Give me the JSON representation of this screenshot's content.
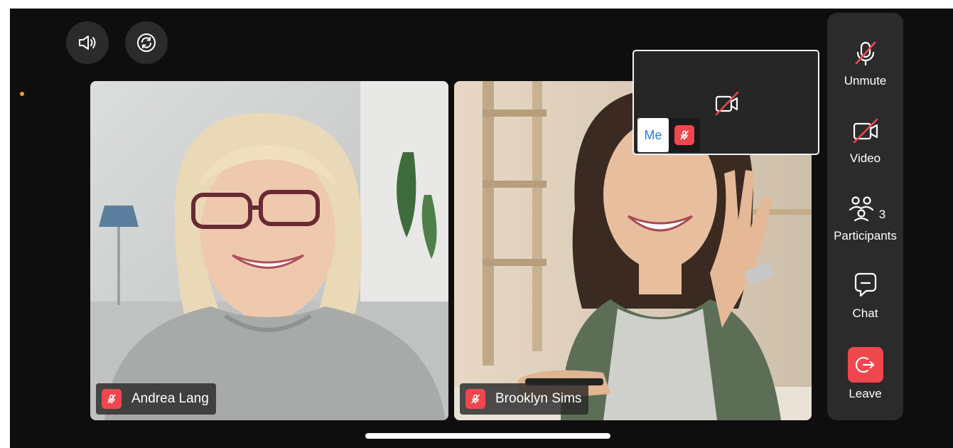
{
  "top_controls": {
    "speaker": "speaker-icon",
    "switch_camera": "switch-camera-icon"
  },
  "participants": [
    {
      "name": "Andrea Lang",
      "muted": true
    },
    {
      "name": "Brooklyn Sims",
      "muted": true
    }
  ],
  "self_view": {
    "label": "Me",
    "camera_off": true,
    "muted": true
  },
  "sidebar": {
    "unmute_label": "Unmute",
    "video_label": "Video",
    "participants_label": "Participants",
    "participants_count": "3",
    "chat_label": "Chat",
    "leave_label": "Leave"
  },
  "colors": {
    "background": "#0e0e0e",
    "panel": "#2b2b2b",
    "danger": "#f0474f",
    "me_text": "#2f7cd8"
  }
}
